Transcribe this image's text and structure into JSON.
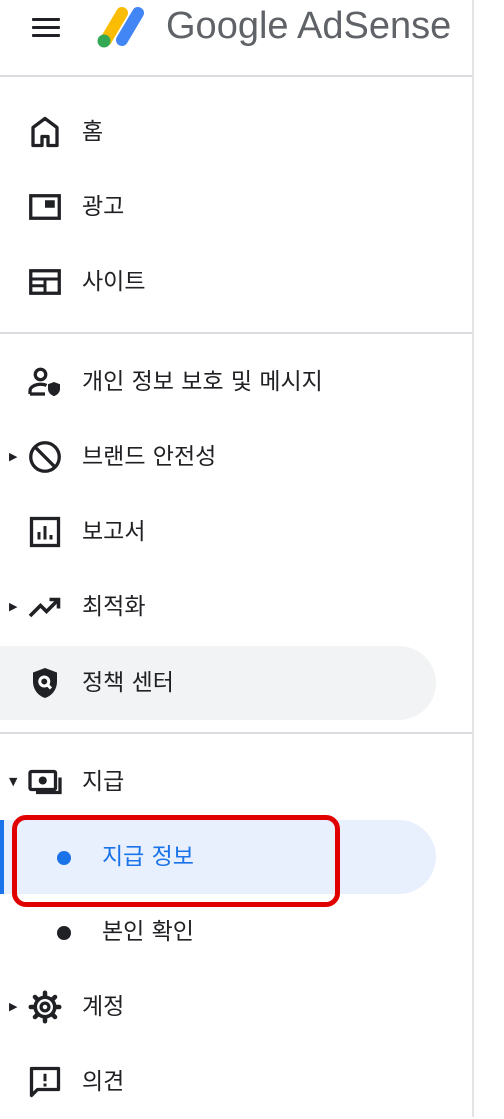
{
  "header": {
    "brand": "Google AdSense"
  },
  "nav": {
    "home": "홈",
    "ads": "광고",
    "sites": "사이트",
    "privacy": "개인 정보 보호 및 메시지",
    "brand_safety": "브랜드 안전성",
    "reports": "보고서",
    "optimization": "최적화",
    "policy_center": "정책 센터",
    "payments": "지급",
    "payments_info": "지급 정보",
    "identity_verification": "본인 확인",
    "account": "계정",
    "feedback": "의견"
  },
  "icons": {
    "menu": "menu-icon",
    "home": "home-icon",
    "ads": "ad-unit-icon",
    "sites": "web-icon",
    "privacy": "privacy-person-icon",
    "brand_safety": "block-icon",
    "reports": "bar-chart-icon",
    "optimization": "trending-up-icon",
    "policy_center": "shield-search-icon",
    "payments": "payments-icon",
    "account": "gear-icon",
    "feedback": "feedback-icon"
  },
  "colors": {
    "accent": "#1a73e8",
    "highlight_box": "#e00000",
    "active_bg": "#f1f3f4",
    "selected_bg": "#e8f0fe"
  }
}
